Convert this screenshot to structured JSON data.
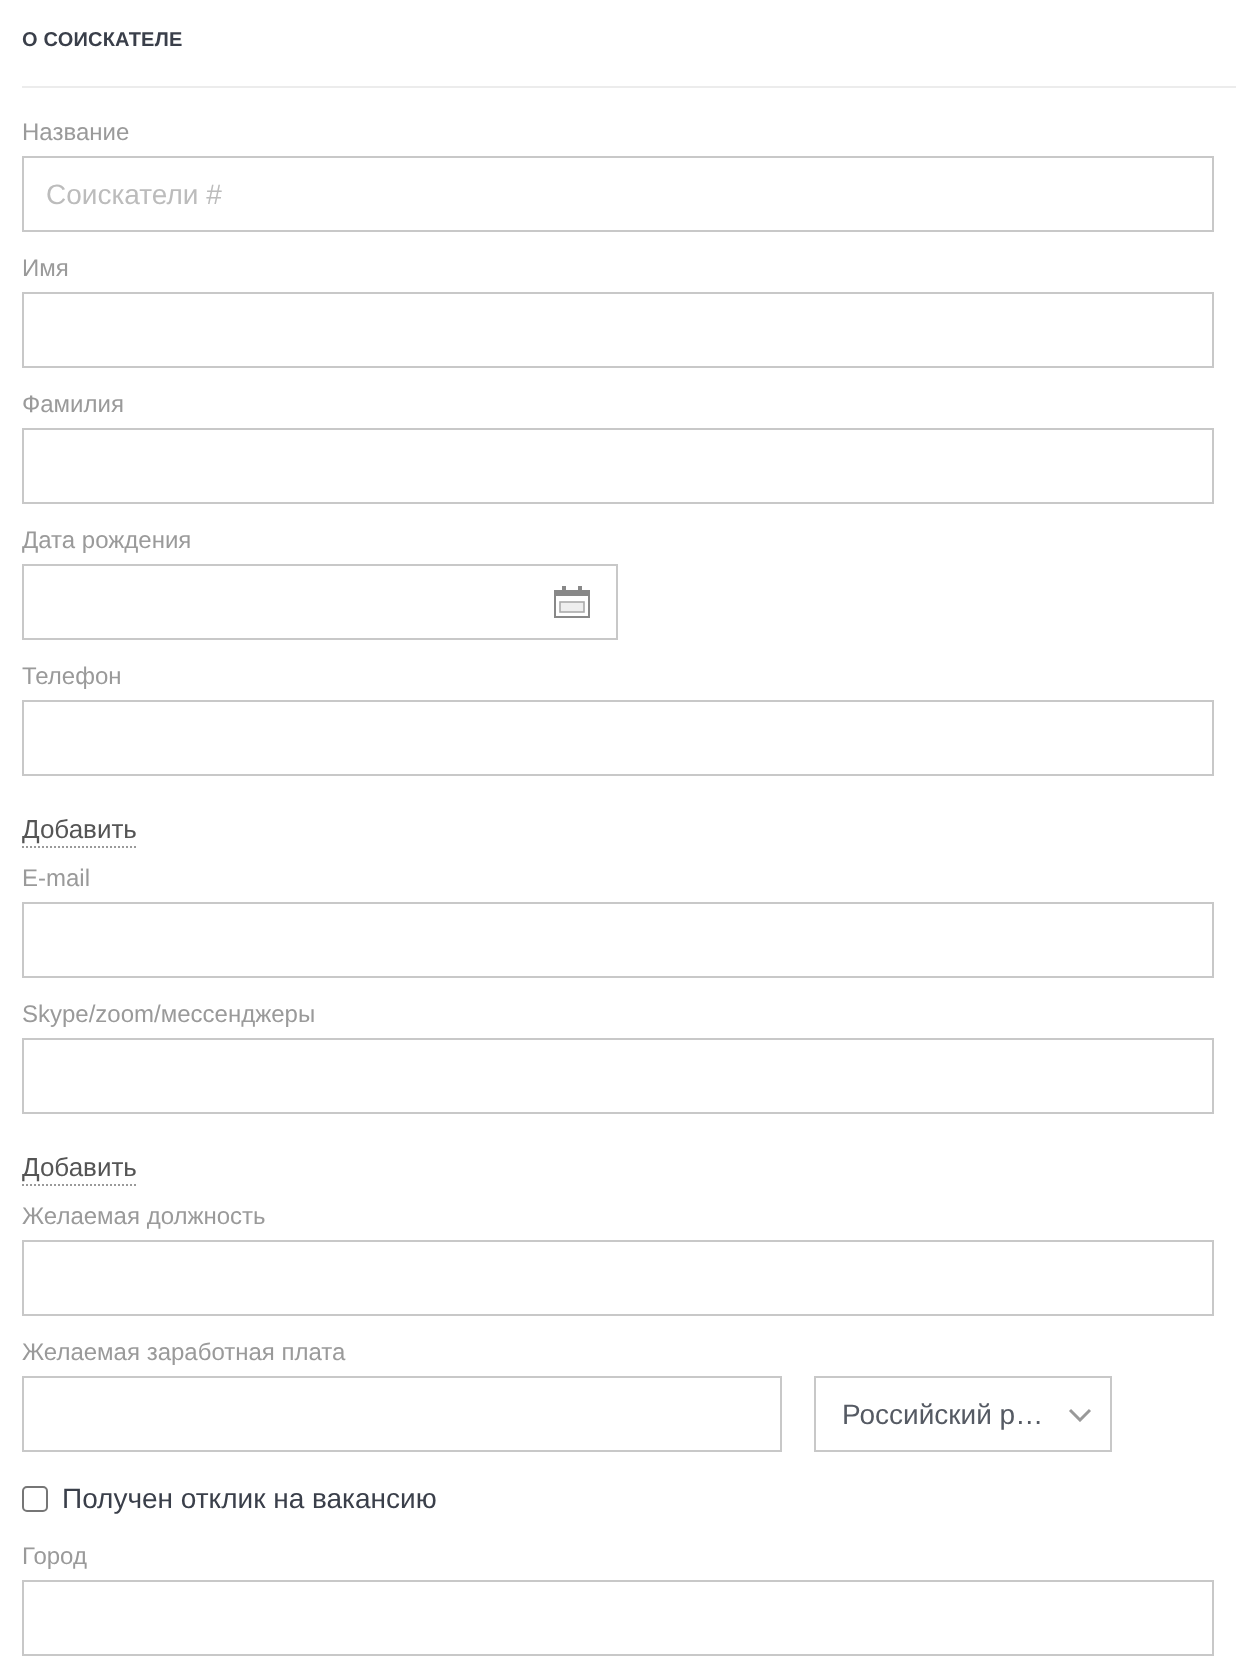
{
  "section": {
    "title": "О СОИСКАТЕЛЕ"
  },
  "fields": [
    {
      "kind": "text",
      "label": "Название",
      "placeholder": "Соискатели #"
    },
    {
      "kind": "text",
      "label": "Имя"
    },
    {
      "kind": "text",
      "label": "Фамилия"
    },
    {
      "kind": "date",
      "label": "Дата рождения"
    },
    {
      "kind": "text",
      "label": "Телефон"
    },
    {
      "kind": "link",
      "text": "Добавить"
    },
    {
      "kind": "text",
      "label": "E-mail"
    },
    {
      "kind": "text",
      "label": "Skype/zoom/мессенджеры"
    },
    {
      "kind": "link",
      "text": "Добавить"
    },
    {
      "kind": "text",
      "label": "Желаемая должность"
    },
    {
      "kind": "money",
      "label": "Желаемая заработная плата",
      "currency": "Российский р…"
    },
    {
      "kind": "checkbox",
      "label": "Получен отклик на вакансию",
      "checked": false
    },
    {
      "kind": "text",
      "label": "Город"
    }
  ]
}
